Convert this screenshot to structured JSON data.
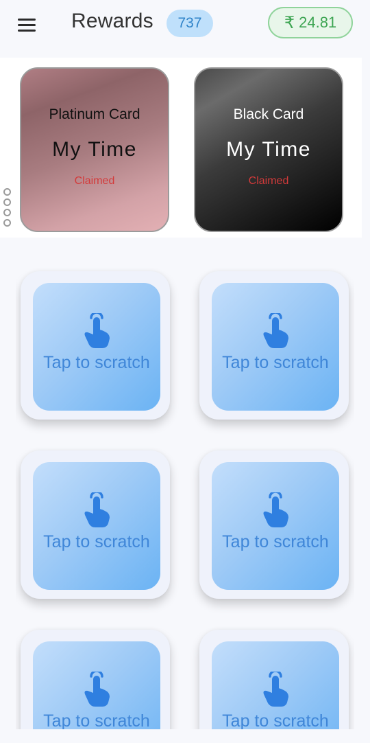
{
  "header": {
    "menu_icon": "hamburger-menu-icon",
    "title": "Rewards",
    "points": "737",
    "wallet_currency_icon": "rupee-icon",
    "wallet_currency_symbol": "₹",
    "wallet_amount": "24.81"
  },
  "colors": {
    "accent_blue": "#3f86d8",
    "wallet_green": "#3ea553",
    "claimed_red": "#d33a3a"
  },
  "premium_cards": [
    {
      "name": "Platinum Card",
      "brand": "My Time",
      "status": "Claimed"
    },
    {
      "name": "Black Card",
      "brand": "My Time",
      "status": "Claimed"
    }
  ],
  "scratch_cards": [
    {
      "icon": "tap-finger-icon",
      "label": "Tap to scratch"
    },
    {
      "icon": "tap-finger-icon",
      "label": "Tap to scratch"
    },
    {
      "icon": "tap-finger-icon",
      "label": "Tap to scratch"
    },
    {
      "icon": "tap-finger-icon",
      "label": "Tap to scratch"
    },
    {
      "icon": "tap-finger-icon",
      "label": "Tap to scratch"
    },
    {
      "icon": "tap-finger-icon",
      "label": "Tap to scratch"
    }
  ]
}
